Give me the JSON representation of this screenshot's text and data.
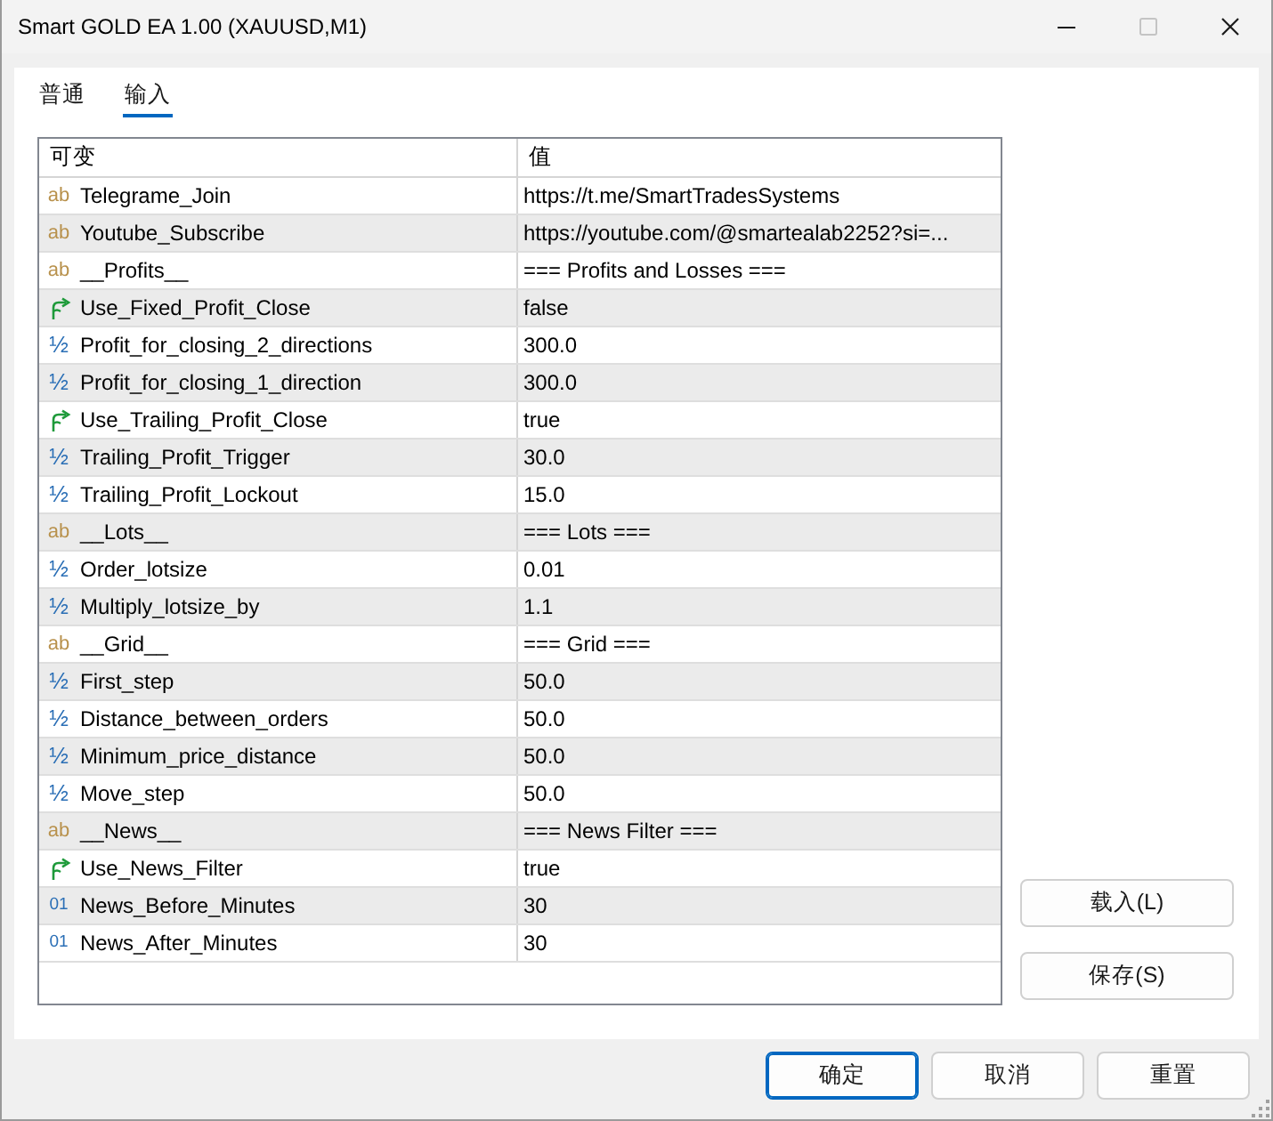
{
  "window": {
    "title": "Smart GOLD EA 1.00 (XAUUSD,M1)",
    "controls": [
      {
        "kind": "minimize",
        "disabled": false
      },
      {
        "kind": "maximize",
        "disabled": true
      },
      {
        "kind": "close",
        "disabled": false
      }
    ]
  },
  "tabs": [
    {
      "label": "普通",
      "selected": false
    },
    {
      "label": "输入",
      "selected": true
    }
  ],
  "table": {
    "columns": [
      "可变",
      "值"
    ],
    "rows": [
      {
        "kind": "string",
        "icon": "ab",
        "name": "Telegrame_Join",
        "value": "https://t.me/SmartTradesSystems"
      },
      {
        "kind": "string",
        "icon": "ab",
        "name": "Youtube_Subscribe",
        "value": "https://youtube.com/@smartealab2252?si=..."
      },
      {
        "kind": "string",
        "icon": "ab",
        "name": "__Profits__",
        "value": "=== Profits and Losses ==="
      },
      {
        "kind": "bool",
        "name": "Use_Fixed_Profit_Close",
        "value": "false"
      },
      {
        "kind": "double",
        "icon": "½",
        "name": "Profit_for_closing_2_directions",
        "value": "300.0"
      },
      {
        "kind": "double",
        "icon": "½",
        "name": "Profit_for_closing_1_direction",
        "value": "300.0"
      },
      {
        "kind": "bool",
        "name": "Use_Trailing_Profit_Close",
        "value": "true"
      },
      {
        "kind": "double",
        "icon": "½",
        "name": "Trailing_Profit_Trigger",
        "value": "30.0"
      },
      {
        "kind": "double",
        "icon": "½",
        "name": "Trailing_Profit_Lockout",
        "value": "15.0"
      },
      {
        "kind": "string",
        "icon": "ab",
        "name": "__Lots__",
        "value": "=== Lots ==="
      },
      {
        "kind": "double",
        "icon": "½",
        "name": "Order_lotsize",
        "value": "0.01"
      },
      {
        "kind": "double",
        "icon": "½",
        "name": "Multiply_lotsize_by",
        "value": "1.1"
      },
      {
        "kind": "string",
        "icon": "ab",
        "name": "__Grid__",
        "value": "=== Grid ==="
      },
      {
        "kind": "double",
        "icon": "½",
        "name": "First_step",
        "value": "50.0"
      },
      {
        "kind": "double",
        "icon": "½",
        "name": "Distance_between_orders",
        "value": "50.0"
      },
      {
        "kind": "double",
        "icon": "½",
        "name": "Minimum_price_distance",
        "value": "50.0"
      },
      {
        "kind": "double",
        "icon": "½",
        "name": "Move_step",
        "value": "50.0"
      },
      {
        "kind": "string",
        "icon": "ab",
        "name": "__News__",
        "value": "=== News Filter ==="
      },
      {
        "kind": "bool",
        "name": "Use_News_Filter",
        "value": "true"
      },
      {
        "kind": "int",
        "icon": "01",
        "name": "News_Before_Minutes",
        "value": "30"
      },
      {
        "kind": "int",
        "icon": "01",
        "name": "News_After_Minutes",
        "value": "30"
      }
    ]
  },
  "side_buttons": [
    "载入(L)",
    "保存(S)"
  ],
  "buttons": [
    {
      "label": "确定",
      "default": true
    },
    {
      "label": "取消",
      "default": false
    },
    {
      "label": "重置",
      "default": false
    }
  ]
}
